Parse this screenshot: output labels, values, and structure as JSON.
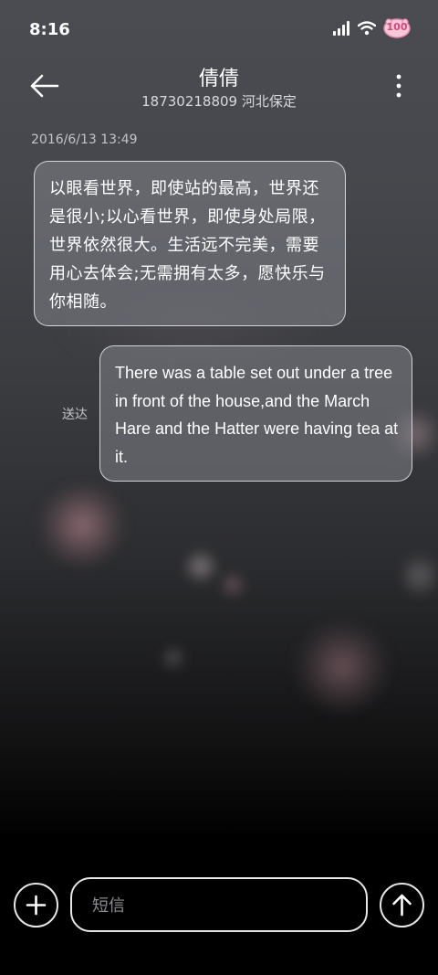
{
  "status_bar": {
    "time": "8:16",
    "battery_level": "100",
    "icons": [
      "signal-icon",
      "wifi-icon",
      "battery-icon"
    ]
  },
  "header": {
    "contact_name": "倩倩",
    "subtitle": "18730218809 河北保定",
    "back_icon": "arrow-left-icon",
    "more_icon": "vertical-dots-icon"
  },
  "conversation": {
    "timestamp": "2016/6/13 13:49",
    "messages": [
      {
        "direction": "incoming",
        "text": "以眼看世界，即使站的最高，世界还是很小;以心看世界，即使身处局限，世界依然很大。生活远不完美，需要用心去体会;无需拥有太多，愿快乐与你相随。"
      },
      {
        "direction": "outgoing",
        "text": "There was a table set out under a tree in front of the house,and the March Hare and the Hatter were having tea at it.",
        "status": "送达"
      }
    ]
  },
  "composer": {
    "placeholder": "短信",
    "add_icon": "plus-icon",
    "send_icon": "arrow-up-icon"
  },
  "colors": {
    "bubble_bg": "#7f8187",
    "bubble_border": "#e6e6eb",
    "meta_text": "#c3c4c8",
    "placeholder_text": "#8c8d91"
  }
}
